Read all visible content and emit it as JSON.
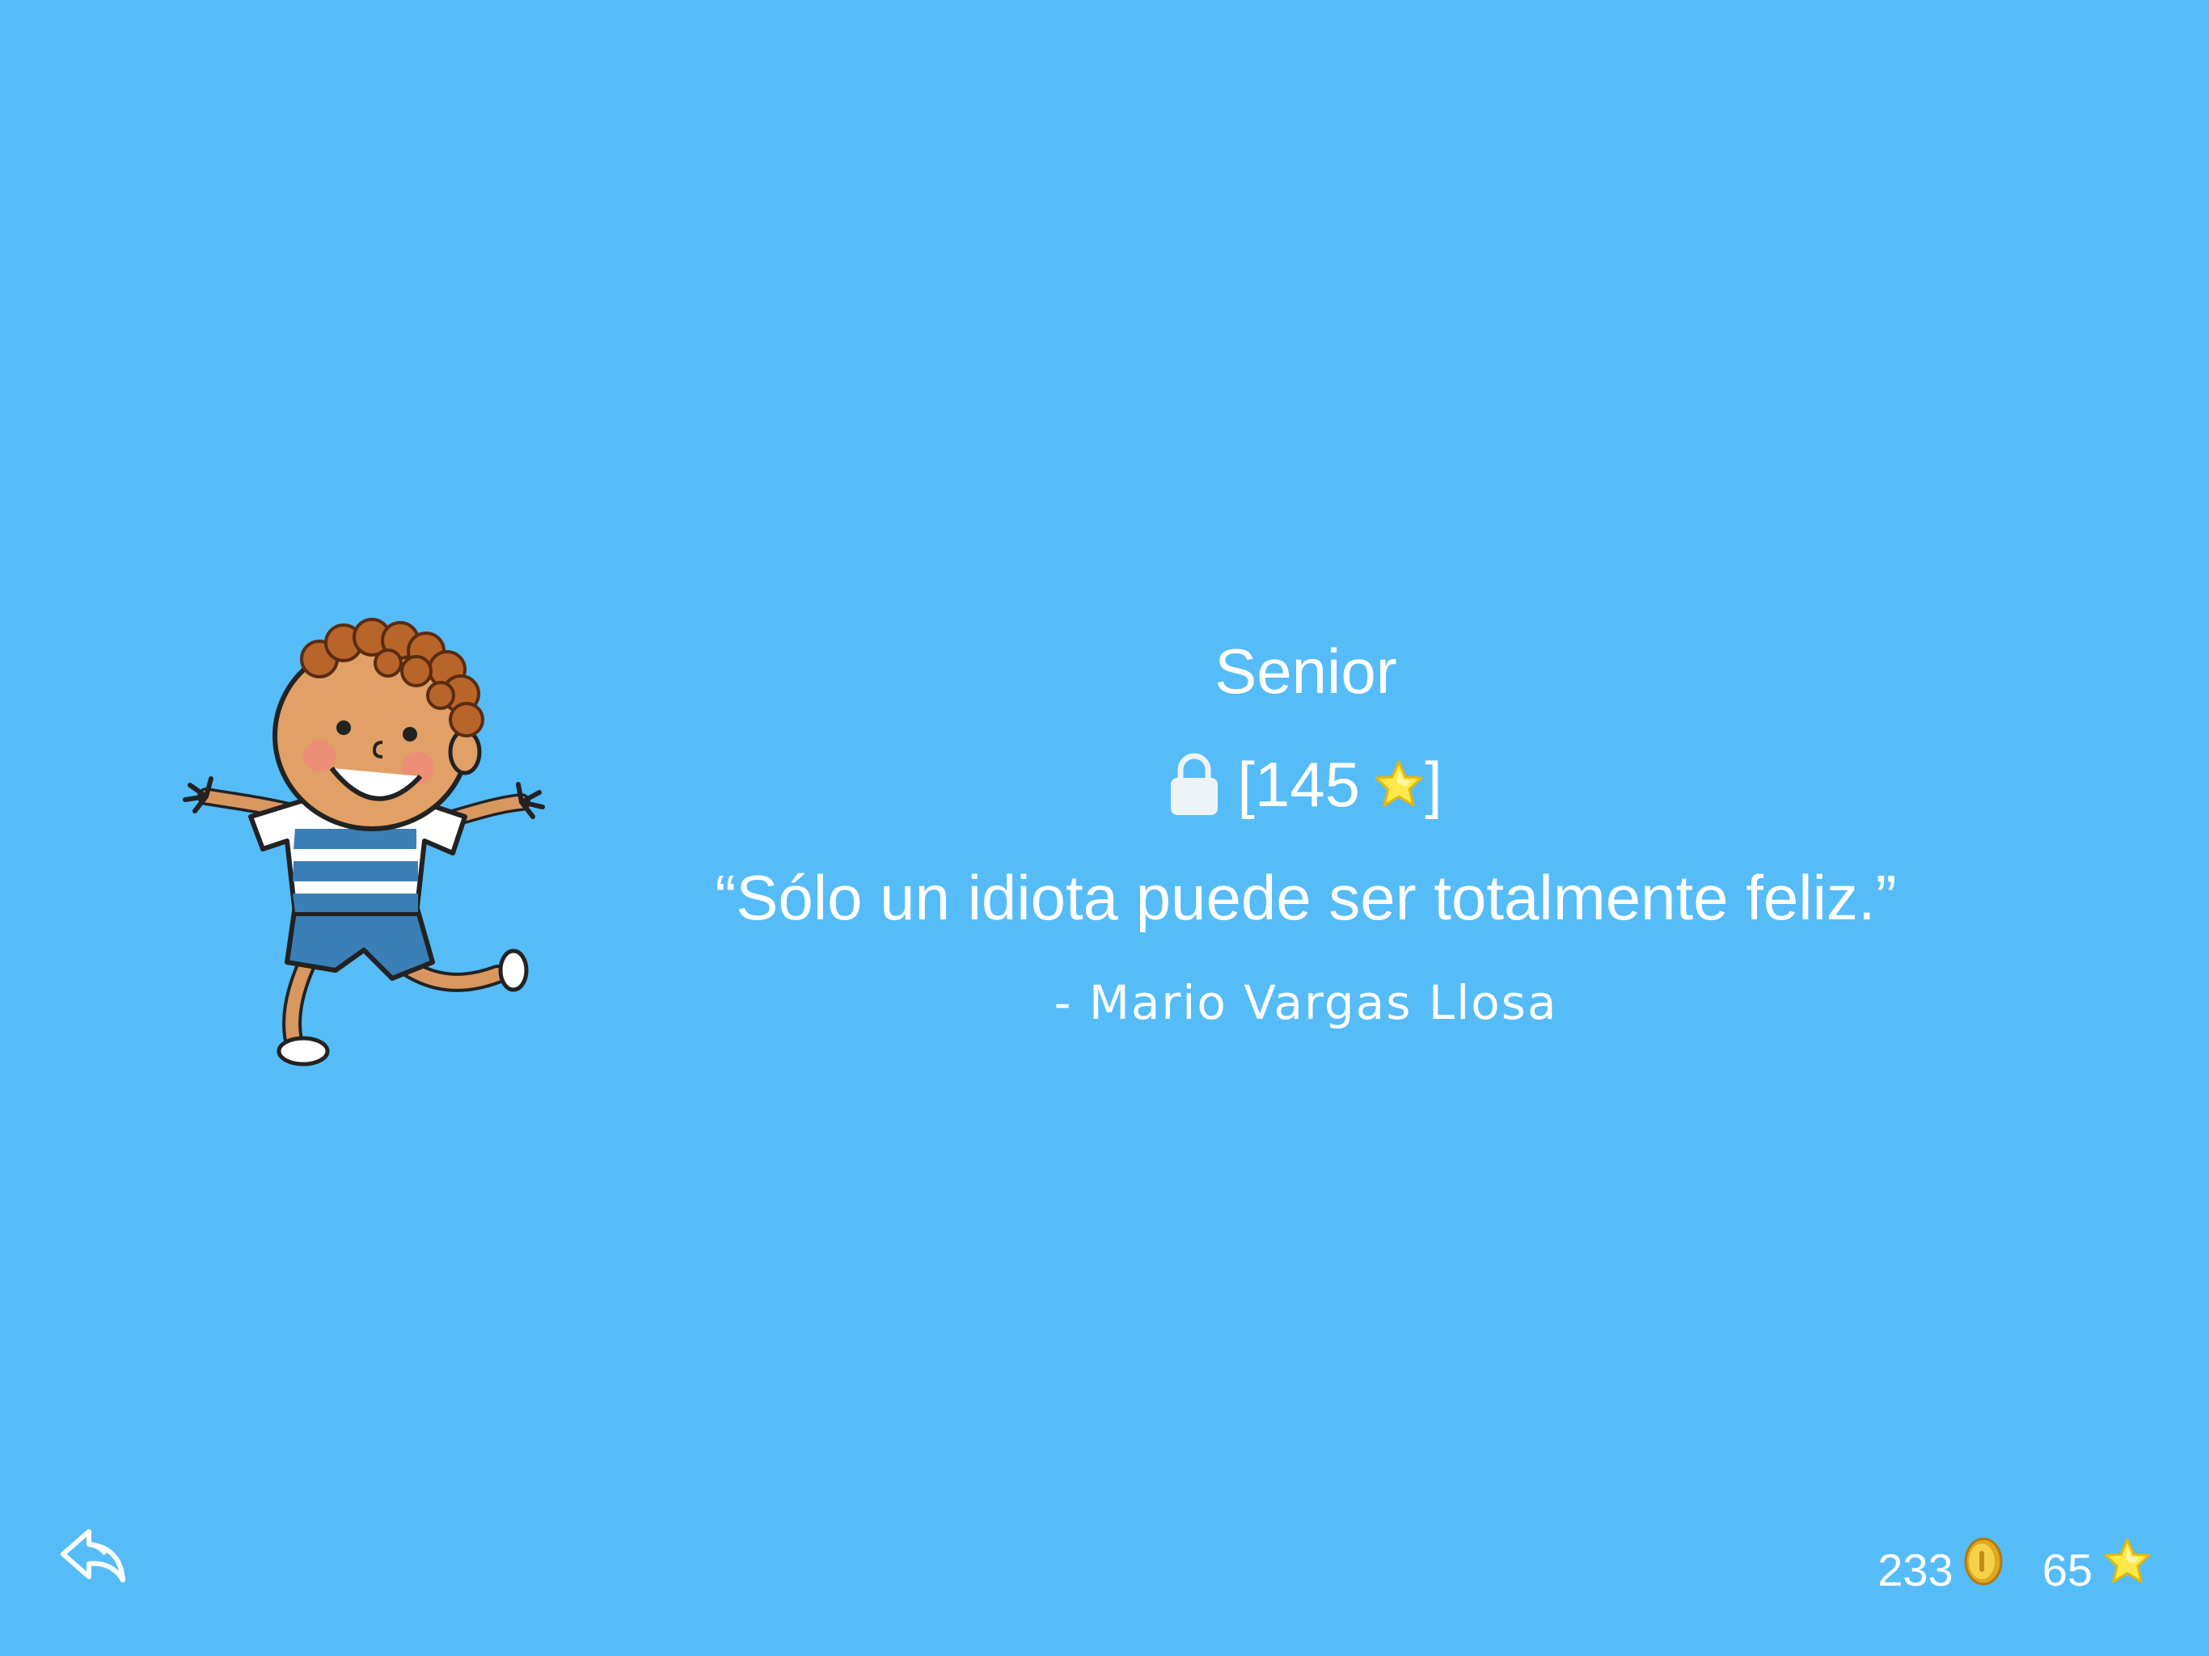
{
  "level": {
    "title": "Senior",
    "required_stars": "[145",
    "required_close": "]"
  },
  "quote": {
    "text": "“Sólo un idiota puede ser totalmente feliz.”",
    "author": "- Mario Vargas Llosa"
  },
  "stats": {
    "coins": "233",
    "stars": "65"
  },
  "icons": {
    "lock": "lock-icon",
    "star": "star-icon",
    "coin": "coin-icon",
    "back": "back-arrow-icon"
  },
  "colors": {
    "background": "#55bcf8",
    "text": "#ffffff",
    "star": "#ffe94a",
    "coin": "#f2c230"
  }
}
